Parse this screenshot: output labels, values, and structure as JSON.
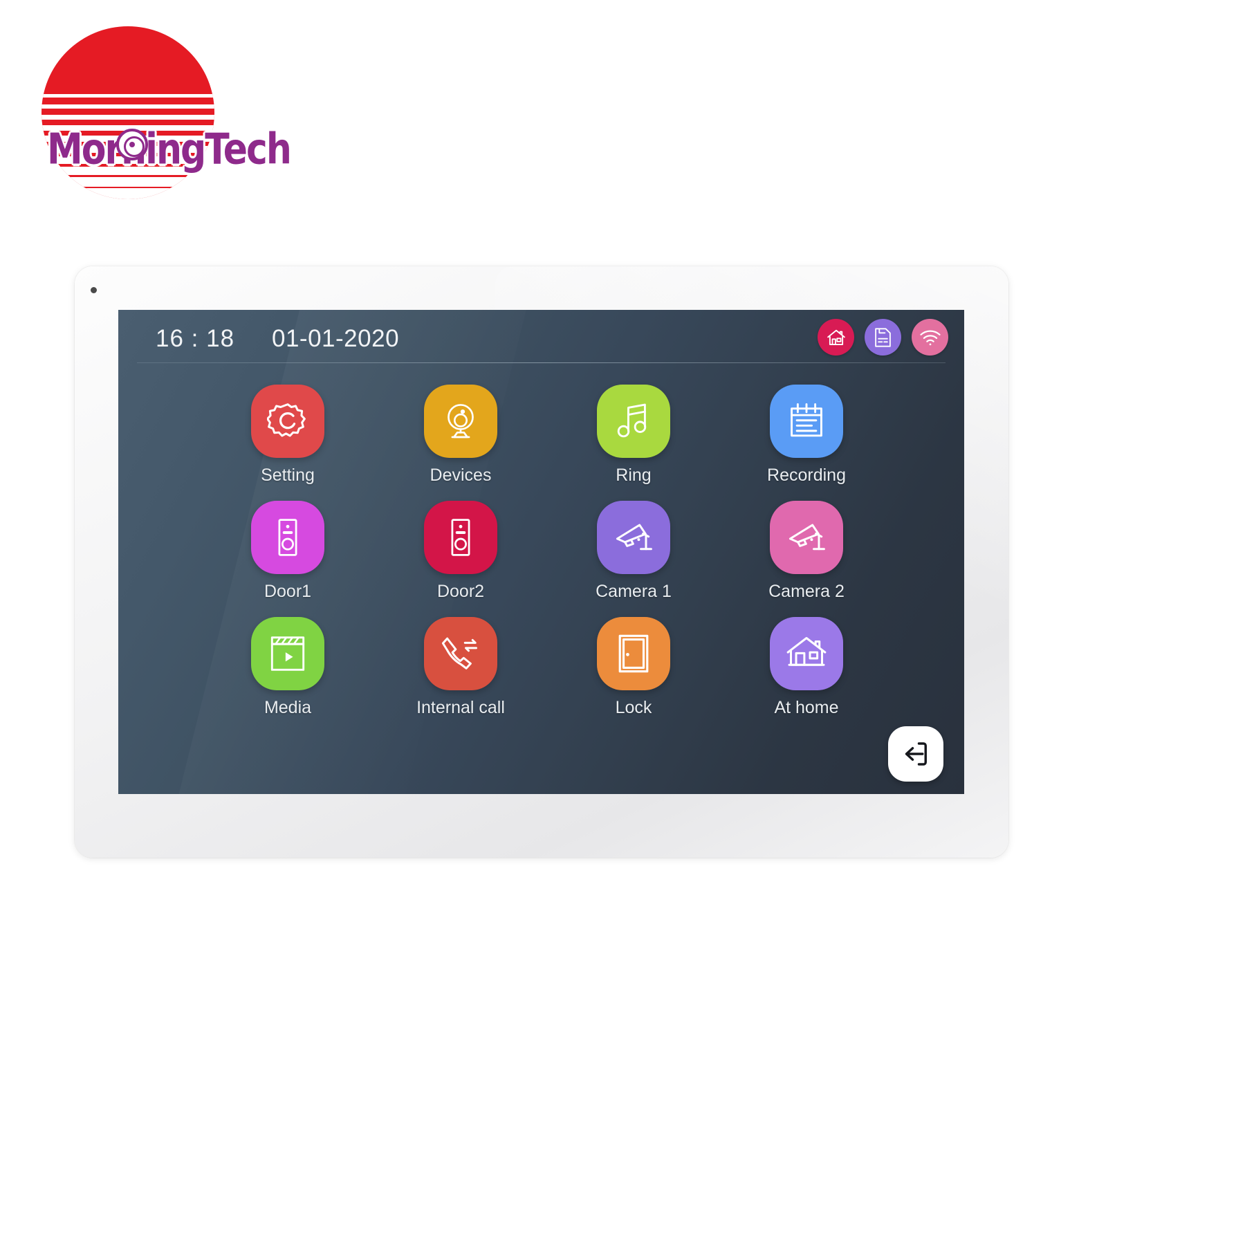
{
  "brand": {
    "name": "MorningTech",
    "logo_sun_color": "#e51b24",
    "logo_text_color": "#8e2a8b"
  },
  "device": {
    "bezel_color": "#f2f2f3",
    "screen_bg_from": "#4a5e70",
    "screen_bg_to": "#29313d"
  },
  "status_bar": {
    "time": "16 : 18",
    "date": "01-01-2020",
    "icons": [
      {
        "name": "home-icon",
        "label": "Home",
        "color": "#d81b54"
      },
      {
        "name": "sd-card-icon",
        "label": "Storage",
        "color": "#8b6ddc"
      },
      {
        "name": "wifi-icon",
        "label": "Wi-Fi",
        "color": "#e3709f"
      }
    ]
  },
  "apps": [
    {
      "label": "Setting",
      "icon": "gear-icon",
      "color": "#e0494a"
    },
    {
      "label": "Devices",
      "icon": "webcam-icon",
      "color": "#e3a61c"
    },
    {
      "label": "Ring",
      "icon": "music-note-icon",
      "color": "#a9d93f"
    },
    {
      "label": "Recording",
      "icon": "notepad-icon",
      "color": "#5a9cf5"
    },
    {
      "label": "Door1",
      "icon": "doorbell-icon",
      "color": "#d64ae0"
    },
    {
      "label": "Door2",
      "icon": "doorbell-icon",
      "color": "#d31548"
    },
    {
      "label": "Camera 1",
      "icon": "cctv-camera-icon",
      "color": "#8b6ddc"
    },
    {
      "label": "Camera 2",
      "icon": "cctv-camera-icon",
      "color": "#e069ae"
    },
    {
      "label": "Media",
      "icon": "clapperboard-icon",
      "color": "#80d343"
    },
    {
      "label": "Internal call",
      "icon": "call-transfer-icon",
      "color": "#d8503f"
    },
    {
      "label": "Lock",
      "icon": "door-icon",
      "color": "#ec8c3c"
    },
    {
      "label": "At home",
      "icon": "house-icon",
      "color": "#9b79e8"
    }
  ],
  "back_button": {
    "label": "Back",
    "icon": "exit-arrow-icon",
    "color": "#ffffff"
  }
}
